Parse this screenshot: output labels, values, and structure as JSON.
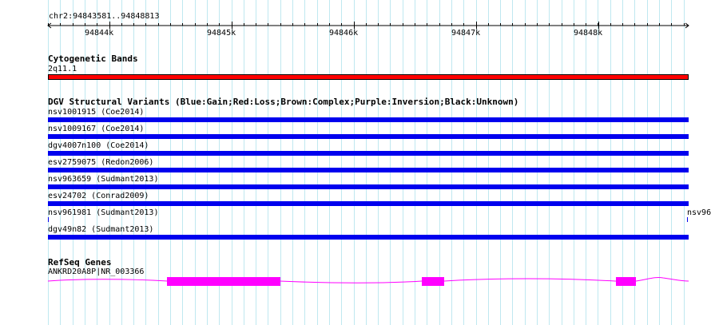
{
  "ruler": {
    "range_label": "chr2:94843581..94848813",
    "ticks": [
      "94844k",
      "94845k",
      "94846k",
      "94847k",
      "94848k"
    ]
  },
  "cytoband": {
    "track_title": "Cytogenetic Bands",
    "band_label": "2q11.1",
    "color": "#ff0000"
  },
  "dgv": {
    "track_title": "DGV Structural Variants (Blue:Gain;Red:Loss;Brown:Complex;Purple:Inversion;Black:Unknown)",
    "gain_color": "#0000ee",
    "variants": [
      {
        "label": "nsv1001915 (Coe2014)"
      },
      {
        "label": "nsv1009167 (Coe2014)"
      },
      {
        "label": "dgv4007n100 (Coe2014)"
      },
      {
        "label": "esv2759075 (Redon2006)"
      },
      {
        "label": "nsv963659 (Sudmant2013)"
      },
      {
        "label": "esv24702 (Conrad2009)"
      },
      {
        "label": "nsv961981 (Sudmant2013)",
        "right_label": "nsv96"
      },
      {
        "label": "dgv49n82 (Sudmant2013)"
      }
    ]
  },
  "refseq": {
    "track_title": "RefSeq Genes",
    "gene_label": "ANKRD20A8P|NR_003366",
    "color": "#ff00ff"
  }
}
